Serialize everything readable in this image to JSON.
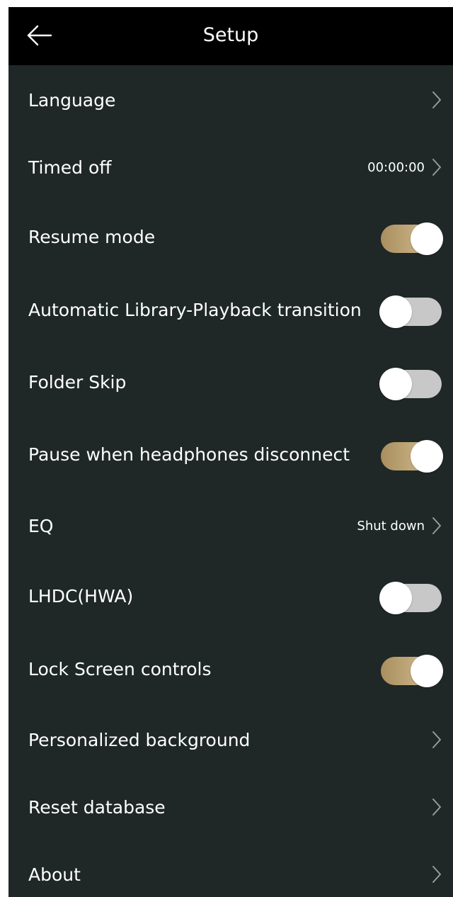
{
  "header": {
    "title": "Setup",
    "back_icon": "arrow-left-icon"
  },
  "colors": {
    "background": "#1f2727",
    "header_background": "#000000",
    "toggle_on": "#c8ad7a",
    "toggle_off": "#c8c8c8",
    "text": "#ffffff"
  },
  "settings": [
    {
      "label": "Language",
      "kind": "link"
    },
    {
      "label": "Timed off",
      "kind": "link",
      "value": "00:00:00"
    },
    {
      "label": "Resume mode",
      "kind": "toggle",
      "on": true
    },
    {
      "label": "Automatic Library-Playback transition",
      "kind": "toggle",
      "on": false
    },
    {
      "label": "Folder Skip",
      "kind": "toggle",
      "on": false
    },
    {
      "label": "Pause when headphones disconnect",
      "kind": "toggle",
      "on": true
    },
    {
      "label": "EQ",
      "kind": "link",
      "value": "Shut down"
    },
    {
      "label": "LHDC(HWA)",
      "kind": "toggle",
      "on": false
    },
    {
      "label": "Lock Screen controls",
      "kind": "toggle",
      "on": true
    },
    {
      "label": "Personalized background",
      "kind": "link"
    },
    {
      "label": "Reset database",
      "kind": "link"
    },
    {
      "label": "About",
      "kind": "link"
    }
  ]
}
